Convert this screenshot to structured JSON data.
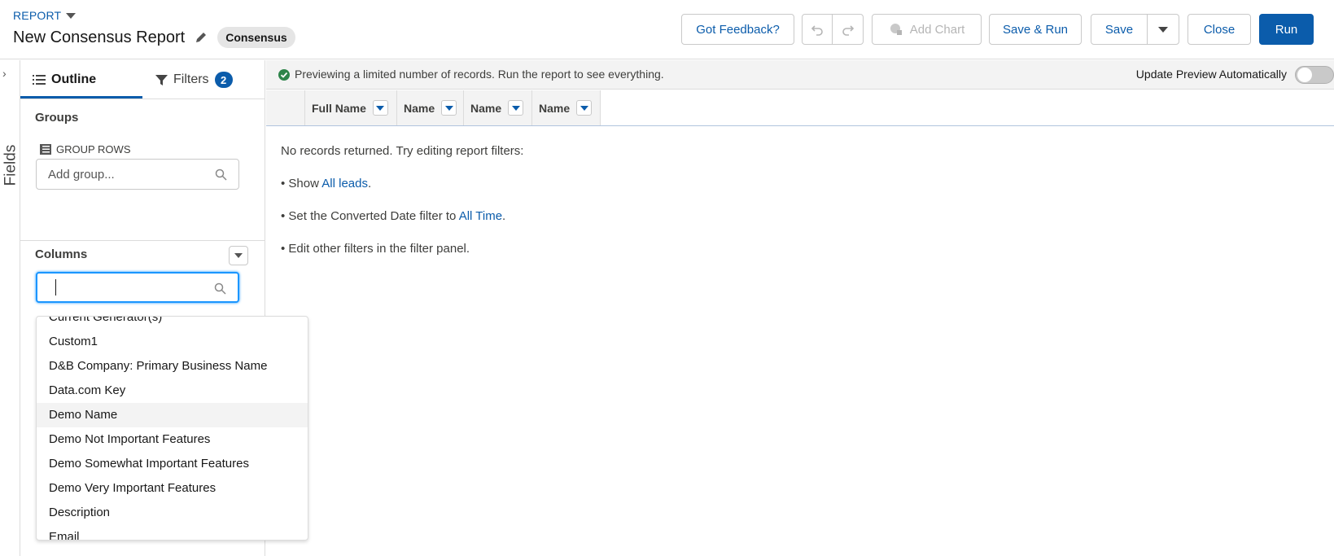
{
  "header": {
    "report_label": "REPORT",
    "title": "New Consensus Report",
    "report_type_badge": "Consensus",
    "buttons": {
      "feedback": "Got Feedback?",
      "add_chart": "Add Chart",
      "save_run": "Save & Run",
      "save": "Save",
      "close": "Close",
      "run": "Run"
    }
  },
  "rail": {
    "label": "Fields"
  },
  "panel": {
    "tabs": {
      "outline": "Outline",
      "filters": "Filters",
      "filters_count": "2"
    },
    "groups": {
      "title": "Groups",
      "group_rows_label": "GROUP ROWS",
      "search_placeholder": "Add group..."
    },
    "columns": {
      "title": "Columns",
      "search_value": ""
    },
    "dropdown_items": [
      "Current Generator(s)",
      "Custom1",
      "D&B Company: Primary Business Name",
      "Data.com Key",
      "Demo Name",
      "Demo Not Important Features",
      "Demo Somewhat Important Features",
      "Demo Very Important Features",
      "Description",
      "Email"
    ],
    "highlighted_item": "Demo Name"
  },
  "preview": {
    "message": "Previewing a limited number of records. Run the report to see everything.",
    "auto_update_label": "Update Preview Automatically",
    "auto_update_on": false
  },
  "columns": [
    "Full Name",
    "Name",
    "Name",
    "Name"
  ],
  "empty_state": {
    "intro": "No records returned. Try editing report filters:",
    "line1_prefix": "• Show ",
    "line1_link": "All leads",
    "line1_suffix": ".",
    "line2_prefix": "• Set the Converted Date filter to ",
    "line2_link": "All Time",
    "line2_suffix": ".",
    "line3": "• Edit other filters in the filter panel."
  },
  "colors": {
    "brand": "#0b5cab",
    "success": "#2e844a",
    "focus": "#1b96ff"
  }
}
